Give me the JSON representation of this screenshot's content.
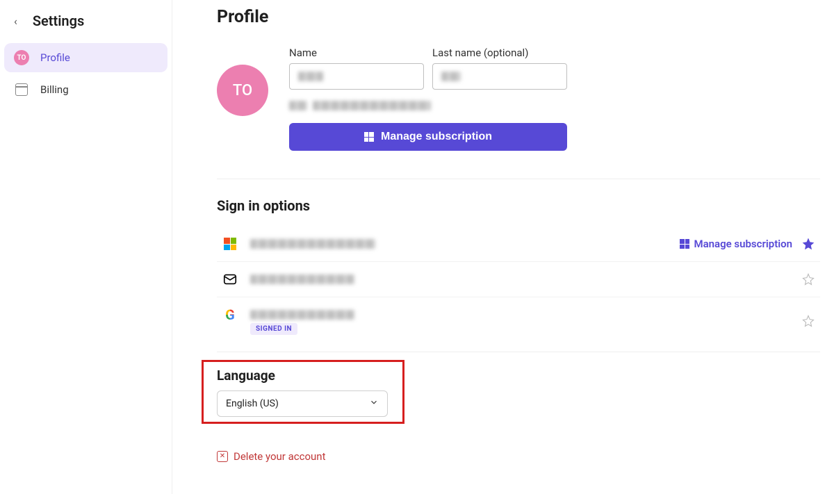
{
  "sidebar": {
    "title": "Settings",
    "items": [
      {
        "label": "Profile"
      },
      {
        "label": "Billing"
      }
    ]
  },
  "avatar_initials": "TO",
  "page": {
    "title": "Profile",
    "name_label": "Name",
    "lastname_label": "Last name (optional)",
    "manage_subscription_label": "Manage subscription"
  },
  "signin": {
    "title": "Sign in options",
    "manage_link_label": "Manage subscription",
    "signed_in_badge": "SIGNED IN"
  },
  "language": {
    "title": "Language",
    "selected": "English (US)"
  },
  "delete": {
    "label": "Delete your account"
  }
}
